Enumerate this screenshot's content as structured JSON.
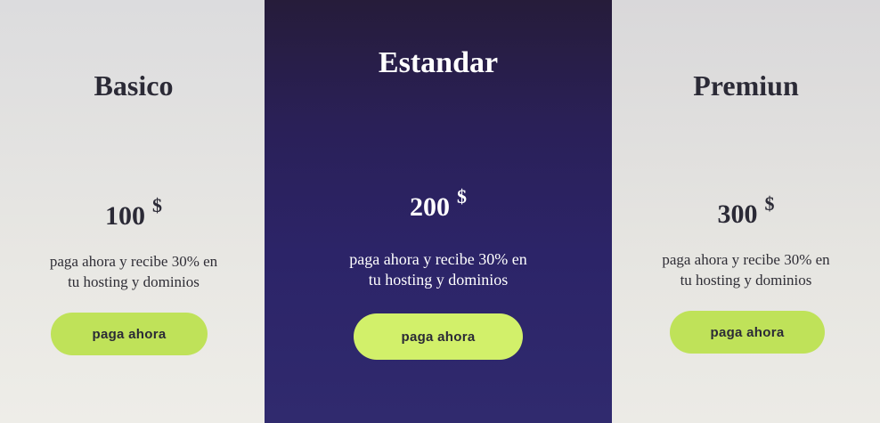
{
  "plans": [
    {
      "title": "Basico",
      "price": "100",
      "currency": "$",
      "description_line1": "paga ahora y recibe 30% en",
      "description_line2": "tu hosting y dominios",
      "button_label": "paga ahora"
    },
    {
      "title": "Estandar",
      "price": "200",
      "currency": "$",
      "description_line1": "paga ahora y recibe 30% en",
      "description_line2": "tu hosting y dominios",
      "button_label": "paga ahora"
    },
    {
      "title": "Premiun",
      "price": "300",
      "currency": "$",
      "description_line1": "paga ahora y recibe 30% en",
      "description_line2": "tu hosting y dominios",
      "button_label": "paga ahora"
    }
  ],
  "colors": {
    "featured_background": "#2c2468",
    "button_accent": "#bfe259",
    "text_dark": "#2b2a36"
  }
}
